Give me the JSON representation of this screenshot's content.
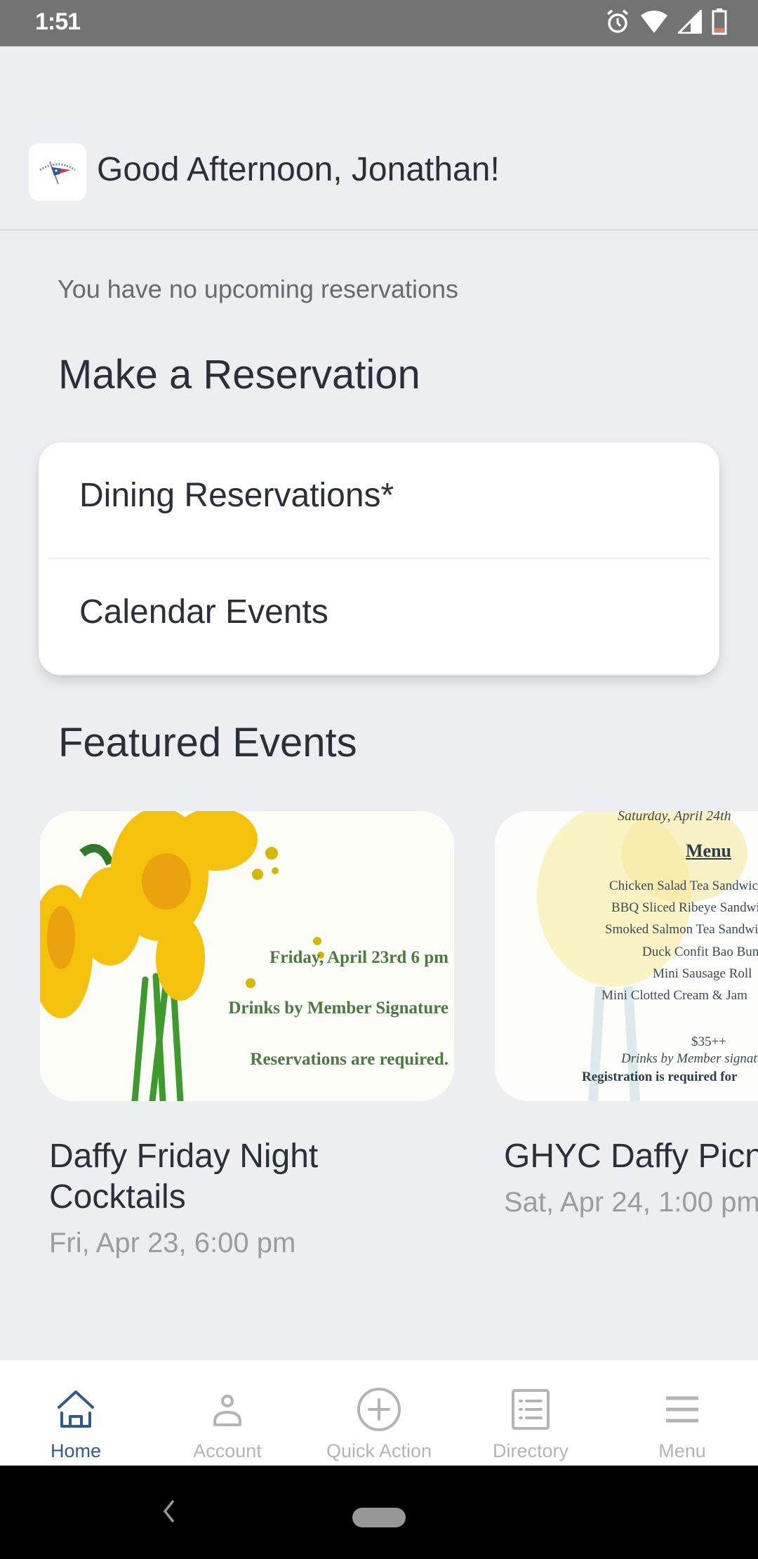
{
  "status_bar": {
    "time": "1:51",
    "icons": [
      "alarm-icon",
      "wifi-icon",
      "signal-icon",
      "battery-low-icon"
    ]
  },
  "header": {
    "logo": "yacht-club-burgee-logo",
    "greeting": "Good Afternoon, Jonathan!"
  },
  "reservations": {
    "empty_message": "You have no upcoming reservations",
    "section_title": "Make a Reservation",
    "items": [
      {
        "label": "Dining Reservations*"
      },
      {
        "label": "Calendar Events"
      }
    ]
  },
  "featured": {
    "section_title": "Featured Events",
    "events": [
      {
        "title": "Daffy Friday Night Cocktails",
        "date": "Fri, Apr 23, 6:00 pm",
        "image_text": [
          "Friday, April 23rd  6 pm",
          "Drinks by Member Signature",
          "Reservations are required."
        ]
      },
      {
        "title": "GHYC Daffy Picnic",
        "date": "Sat, Apr 24, 1:00 pm",
        "image_text": {
          "date": "Saturday, April 24th",
          "heading": "Menu",
          "items": [
            "Chicken Salad Tea Sandwich",
            "BBQ Sliced Ribeye Sandwich",
            "Smoked Salmon Tea Sandwich",
            "Duck Confit Bao Bun",
            "Mini Sausage Roll",
            "Mini Clotted Cream & Jam"
          ],
          "price": "$35++",
          "drinks": "Drinks by Member signature",
          "registration": "Registration is required for"
        }
      }
    ]
  },
  "bottom_nav": {
    "active": "Home",
    "items": [
      {
        "label": "Home",
        "icon": "home-icon"
      },
      {
        "label": "Account",
        "icon": "person-icon"
      },
      {
        "label": "Quick Action",
        "icon": "plus-circle-icon"
      },
      {
        "label": "Directory",
        "icon": "list-document-icon"
      },
      {
        "label": "Menu",
        "icon": "hamburger-menu-icon"
      }
    ]
  },
  "colors": {
    "accent": "#2e5b8c",
    "inactive": "#b3b4b8",
    "background": "#edeef2",
    "text_primary": "#2b2f3a",
    "text_secondary": "#9a9ca2"
  }
}
